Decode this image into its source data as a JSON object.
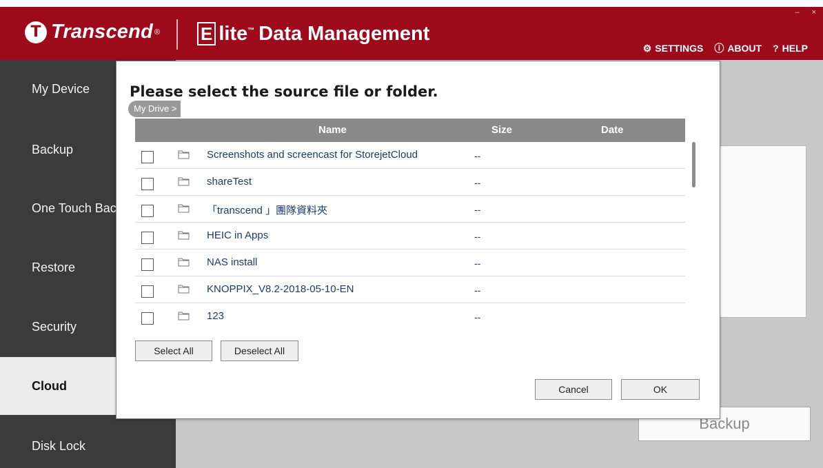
{
  "window": {
    "title": "Transcend Elite"
  },
  "header": {
    "brand": "Transcend",
    "brand_mark": "T",
    "brand_reg": "®",
    "product_mark": "E",
    "product_rest": "lite",
    "product_tm": "™",
    "product_name": "Data Management",
    "window_controls": [
      "–",
      "×"
    ],
    "links": [
      {
        "label": "SETTINGS",
        "icon": "gear-icon",
        "glyph": "⚙"
      },
      {
        "label": "ABOUT",
        "icon": "info-icon",
        "glyph": "ⓘ"
      },
      {
        "label": "HELP",
        "icon": "help-icon",
        "glyph": "?"
      }
    ]
  },
  "sidebar": {
    "items": [
      {
        "label": "My Device"
      },
      {
        "label": "Backup"
      },
      {
        "label": "One Touch Backup"
      },
      {
        "label": "Restore"
      },
      {
        "label": "Security"
      },
      {
        "label": "Cloud",
        "active": true
      },
      {
        "label": "Disk Lock"
      }
    ]
  },
  "background": {
    "backup_button": "Backup"
  },
  "dialog": {
    "title": "Please select the source file or folder.",
    "breadcrumb": "My Drive >",
    "columns": {
      "name": "Name",
      "size": "Size",
      "date": "Date"
    },
    "rows": [
      {
        "name": "Screenshots and screencast for StorejetCloud",
        "size": "--"
      },
      {
        "name": "shareTest",
        "size": "--"
      },
      {
        "name": "「transcend 」團隊資料夾",
        "size": "--"
      },
      {
        "name": "HEIC in Apps",
        "size": "--"
      },
      {
        "name": "NAS install",
        "size": "--"
      },
      {
        "name": "KNOPPIX_V8.2-2018-05-10-EN",
        "size": "--"
      },
      {
        "name": "123",
        "size": "--"
      }
    ],
    "select_all": "Select All",
    "deselect_all": "Deselect All",
    "cancel": "Cancel",
    "ok": "OK"
  },
  "colors": {
    "brand_red": "#9d0a1b",
    "sidebar": "#3b3b3b",
    "header_row": "#8a8a8a"
  }
}
